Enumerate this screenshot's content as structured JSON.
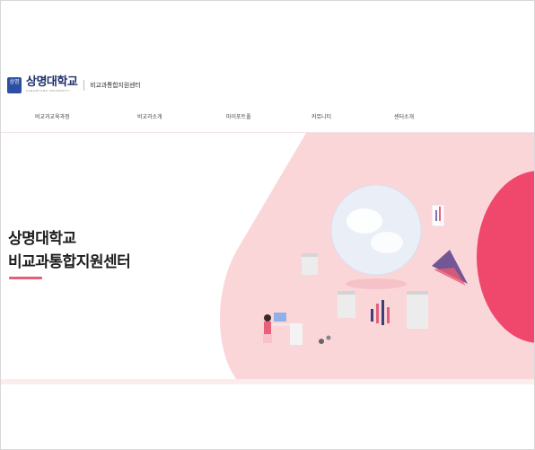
{
  "header": {
    "logo_mark": "상명",
    "university_name": "상명대학교",
    "university_sub": "SANGMYUNG UNIVERSITY",
    "center_name": "비교과통합지원센터"
  },
  "gnb": [
    {
      "label": "비교과교육과정"
    },
    {
      "label": "비교과소개"
    },
    {
      "label": "마이포트폴"
    },
    {
      "label": "커뮤니티"
    },
    {
      "label": "센터소개"
    }
  ],
  "hero": {
    "title_line1": "상명대학교",
    "title_line2": "비교과통합지원센터"
  },
  "colors": {
    "accent": "#e2607a",
    "brand_navy": "#1d2f6b",
    "hero_pink": "#fbd6d9",
    "circle_red": "#f0476d"
  }
}
